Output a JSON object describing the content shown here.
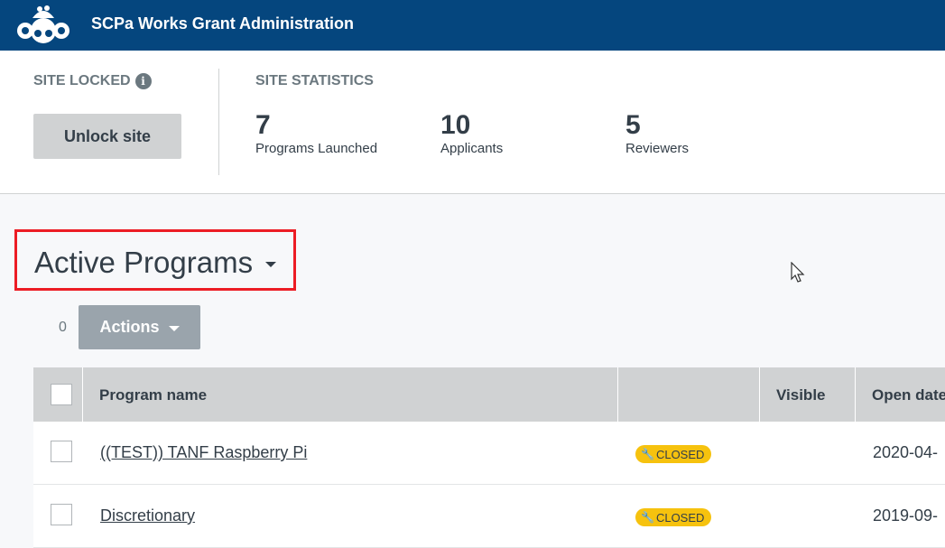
{
  "header": {
    "title": "SCPa Works Grant Administration",
    "logo_icon": "surveymonkey-logo-icon",
    "bg_color": "#05467e"
  },
  "site_lock": {
    "label": "SITE LOCKED",
    "info_glyph": "i",
    "unlock_button": "Unlock site"
  },
  "statistics": {
    "label": "SITE STATISTICS",
    "items": [
      {
        "value": "7",
        "label": "Programs Launched"
      },
      {
        "value": "10",
        "label": "Applicants"
      },
      {
        "value": "5",
        "label": "Reviewers"
      }
    ]
  },
  "programs": {
    "section_title": "Active Programs",
    "selected_count": "0",
    "actions_button": "Actions",
    "columns": [
      "Program name",
      "",
      "Visible",
      "Open date"
    ],
    "rows": [
      {
        "name": "((TEST)) TANF Raspberry Pi",
        "status": "CLOSED",
        "visible": "",
        "open_date": "2020-04-"
      },
      {
        "name": "Discretionary",
        "status": "CLOSED",
        "visible": "",
        "open_date": "2019-09-"
      }
    ],
    "status_color": "#f6c20e",
    "highlight_color": "#ec1c24"
  }
}
